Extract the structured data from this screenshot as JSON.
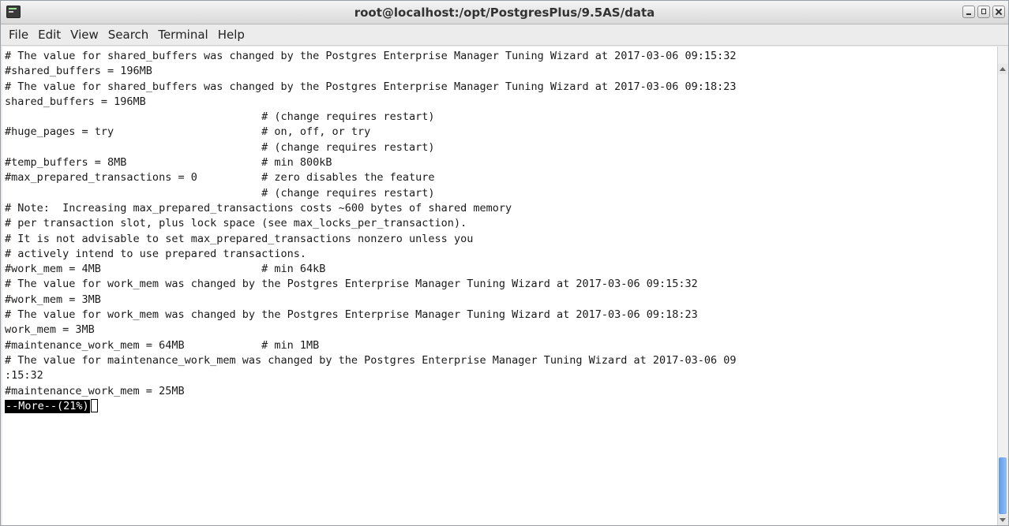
{
  "window": {
    "title": "root@localhost:/opt/PostgresPlus/9.5AS/data",
    "icon": "terminal-icon",
    "controls": [
      "minimize-icon",
      "maximize-icon",
      "close-icon"
    ]
  },
  "menubar": {
    "items": [
      "File",
      "Edit",
      "View",
      "Search",
      "Terminal",
      "Help"
    ]
  },
  "terminal": {
    "lines": [
      "# The value for shared_buffers was changed by the Postgres Enterprise Manager Tuning Wizard at 2017-03-06 09:15:32",
      "#shared_buffers = 196MB",
      "# The value for shared_buffers was changed by the Postgres Enterprise Manager Tuning Wizard at 2017-03-06 09:18:23",
      "shared_buffers = 196MB",
      "                                        # (change requires restart)",
      "#huge_pages = try                       # on, off, or try",
      "                                        # (change requires restart)",
      "#temp_buffers = 8MB                     # min 800kB",
      "#max_prepared_transactions = 0          # zero disables the feature",
      "                                        # (change requires restart)",
      "# Note:  Increasing max_prepared_transactions costs ~600 bytes of shared memory",
      "# per transaction slot, plus lock space (see max_locks_per_transaction).",
      "# It is not advisable to set max_prepared_transactions nonzero unless you",
      "# actively intend to use prepared transactions.",
      "#work_mem = 4MB                         # min 64kB",
      "# The value for work_mem was changed by the Postgres Enterprise Manager Tuning Wizard at 2017-03-06 09:15:32",
      "#work_mem = 3MB",
      "# The value for work_mem was changed by the Postgres Enterprise Manager Tuning Wizard at 2017-03-06 09:18:23",
      "work_mem = 3MB",
      "#maintenance_work_mem = 64MB            # min 1MB",
      "# The value for maintenance_work_mem was changed by the Postgres Enterprise Manager Tuning Wizard at 2017-03-06 09",
      ":15:32",
      "#maintenance_work_mem = 25MB"
    ],
    "pager_prompt": "--More--(21%)"
  }
}
